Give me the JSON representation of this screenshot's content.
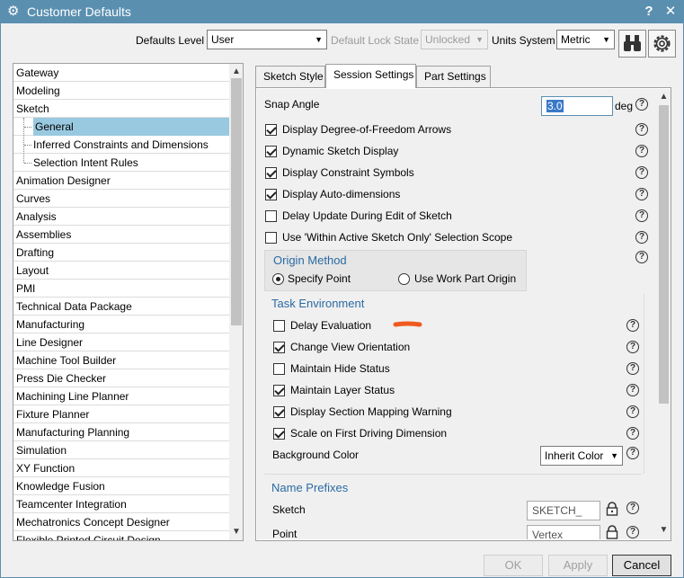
{
  "window": {
    "title": "Customer Defaults",
    "help_glyph": "?",
    "close_glyph": "✕"
  },
  "toolbar": {
    "defaults_level_label": "Defaults Level",
    "defaults_level_value": "User",
    "lock_state_label": "Default Lock State",
    "lock_state_value": "Unlocked",
    "units_label": "Units System",
    "units_value": "Metric"
  },
  "tree": {
    "items": [
      {
        "label": "Gateway",
        "level": 0
      },
      {
        "label": "Modeling",
        "level": 0
      },
      {
        "label": "Sketch",
        "level": 0
      },
      {
        "label": "General",
        "level": 1,
        "selected": true
      },
      {
        "label": "Inferred Constraints and Dimensions",
        "level": 1
      },
      {
        "label": "Selection Intent Rules",
        "level": 1
      },
      {
        "label": "Animation Designer",
        "level": 0
      },
      {
        "label": "Curves",
        "level": 0
      },
      {
        "label": "Analysis",
        "level": 0
      },
      {
        "label": "Assemblies",
        "level": 0
      },
      {
        "label": "Drafting",
        "level": 0
      },
      {
        "label": "Layout",
        "level": 0
      },
      {
        "label": "PMI",
        "level": 0
      },
      {
        "label": "Technical Data Package",
        "level": 0
      },
      {
        "label": "Manufacturing",
        "level": 0
      },
      {
        "label": "Line Designer",
        "level": 0
      },
      {
        "label": "Machine Tool Builder",
        "level": 0
      },
      {
        "label": "Press Die Checker",
        "level": 0
      },
      {
        "label": "Machining Line Planner",
        "level": 0
      },
      {
        "label": "Fixture Planner",
        "level": 0
      },
      {
        "label": "Manufacturing Planning",
        "level": 0
      },
      {
        "label": "Simulation",
        "level": 0
      },
      {
        "label": "XY Function",
        "level": 0
      },
      {
        "label": "Knowledge Fusion",
        "level": 0
      },
      {
        "label": "Teamcenter Integration",
        "level": 0
      },
      {
        "label": "Mechatronics Concept Designer",
        "level": 0
      },
      {
        "label": "Flexible Printed Circuit Design",
        "level": 0
      }
    ]
  },
  "tabs": [
    "Sketch Style",
    "Session Settings",
    "Part Settings"
  ],
  "session": {
    "snap_angle_label": "Snap Angle",
    "snap_angle_value": "3.0",
    "snap_angle_unit": "deg",
    "options": [
      {
        "label": "Display Degree-of-Freedom Arrows",
        "checked": true
      },
      {
        "label": "Dynamic Sketch Display",
        "checked": true
      },
      {
        "label": "Display Constraint Symbols",
        "checked": true
      },
      {
        "label": "Display Auto-dimensions",
        "checked": true
      },
      {
        "label": "Delay Update During Edit of Sketch",
        "checked": false
      },
      {
        "label": "Use 'Within Active Sketch Only' Selection Scope",
        "checked": false
      }
    ],
    "origin_method": {
      "title": "Origin Method",
      "option_a": "Specify Point",
      "option_b": "Use Work Part Origin",
      "selected": "Specify Point"
    },
    "task_environment": {
      "title": "Task Environment",
      "options": [
        {
          "label": "Delay Evaluation",
          "checked": false
        },
        {
          "label": "Change View Orientation",
          "checked": true
        },
        {
          "label": "Maintain Hide Status",
          "checked": false
        },
        {
          "label": "Maintain Layer Status",
          "checked": true
        },
        {
          "label": "Display Section Mapping Warning",
          "checked": true
        },
        {
          "label": "Scale on First Driving Dimension",
          "checked": true
        }
      ],
      "background_color_label": "Background Color",
      "background_color_value": "Inherit Color"
    },
    "name_prefixes": {
      "title": "Name Prefixes",
      "sketch_label": "Sketch",
      "sketch_value": "SKETCH_",
      "point_label": "Point",
      "point_value": "Vertex"
    }
  },
  "buttons": {
    "ok": "OK",
    "apply": "Apply",
    "cancel": "Cancel"
  },
  "colors": {
    "titlebar": "#5a8fb0",
    "selection": "#99c9e0",
    "group_title": "#2b6aa3",
    "annotation_mark": "#f05a1e"
  }
}
